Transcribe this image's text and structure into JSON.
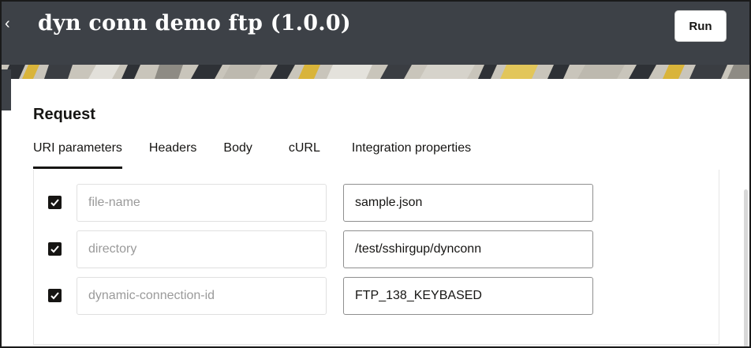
{
  "header": {
    "title": "dyn conn demo ftp (1.0.0)",
    "back_icon": "chevron-left-icon",
    "run_label": "Run"
  },
  "request": {
    "title": "Request",
    "tabs": [
      {
        "label": "URI parameters",
        "active": true
      },
      {
        "label": "Headers",
        "active": false
      },
      {
        "label": "Body",
        "active": false
      },
      {
        "label": "cURL",
        "active": false
      },
      {
        "label": "Integration properties",
        "active": false
      }
    ],
    "parameters": [
      {
        "checked": true,
        "name": "file-name",
        "value": "sample.json"
      },
      {
        "checked": true,
        "name": "directory",
        "value": "/test/sshirgup/dynconn"
      },
      {
        "checked": true,
        "name": "dynamic-connection-id",
        "value": "FTP_138_KEYBASED"
      }
    ]
  },
  "colors": {
    "header_bg": "#3d4147",
    "text": "#161513",
    "placeholder": "#9a9a9a"
  }
}
